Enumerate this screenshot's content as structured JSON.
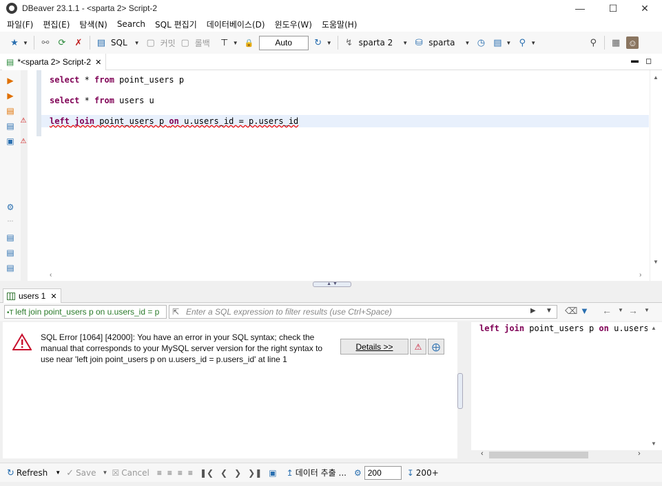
{
  "window": {
    "title": "DBeaver 23.1.1 - <sparta 2> Script-2"
  },
  "menu": [
    "파일(F)",
    "편집(E)",
    "탐색(N)",
    "Search",
    "SQL 편집기",
    "데이터베이스(D)",
    "윈도우(W)",
    "도움말(H)"
  ],
  "toolbar": {
    "sql_label": "SQL",
    "commit_label": "커밋",
    "rollback_label": "롤백",
    "transaction_mode": "Auto",
    "datasource": "sparta 2",
    "schema": "sparta"
  },
  "editor": {
    "tab_title": "*<sparta 2> Script-2",
    "lines": [
      {
        "kw1": "select",
        "mid": " * ",
        "kw2": "from",
        "rest": " point_users p"
      },
      {
        "kw1": "select",
        "mid": " * ",
        "kw2": "from",
        "rest": " users u"
      }
    ],
    "line3": {
      "left": "left",
      "join": "join",
      "a": " point_users p ",
      "on": "on",
      "b": " u.users_id = p.users_id"
    }
  },
  "results": {
    "tab_label": "users 1",
    "query_preview": "left join point_users p on u.users_id = p",
    "filter_placeholder": "Enter a SQL expression to filter results (use Ctrl+Space)",
    "error_message": "SQL Error [1064] [42000]: You have an error in your SQL syntax; check the manual that corresponds to your MySQL server version for the right syntax to use near 'left join point_users p on u.users_id = p.users_id' at line 1",
    "details_label": "Details >>",
    "preview_kw1": "left",
    "preview_kw2": "join",
    "preview_a": " point_users p ",
    "preview_kw3": "on",
    "preview_b": " u.users_"
  },
  "bottombar": {
    "refresh_label": "Refresh",
    "save_label": "Save",
    "cancel_label": "Cancel",
    "export_label": "데이터 추출 ...",
    "fetch_size": "200",
    "fetch_more_label": "200+"
  }
}
